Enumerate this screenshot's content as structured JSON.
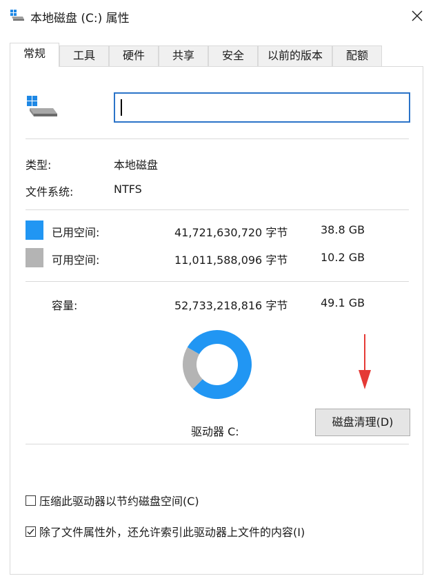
{
  "window": {
    "title": "本地磁盘 (C:) 属性",
    "close_label": "✕"
  },
  "tabs": [
    {
      "label": "常规",
      "active": true
    },
    {
      "label": "工具",
      "active": false
    },
    {
      "label": "硬件",
      "active": false
    },
    {
      "label": "共享",
      "active": false
    },
    {
      "label": "安全",
      "active": false
    },
    {
      "label": "以前的版本",
      "active": false
    },
    {
      "label": "配额",
      "active": false
    }
  ],
  "general": {
    "name_value": "",
    "type_label": "类型:",
    "type_value": "本地磁盘",
    "fs_label": "文件系统:",
    "fs_value": "NTFS",
    "used": {
      "label": "已用空间:",
      "bytes": "41,721,630,720 字节",
      "size": "38.8 GB",
      "color": "#2196f3"
    },
    "free": {
      "label": "可用空间:",
      "bytes": "11,011,588,096 字节",
      "size": "10.2 GB",
      "color": "#b4b4b4"
    },
    "capacity": {
      "label": "容量:",
      "bytes": "52,733,218,816 字节",
      "size": "49.1 GB"
    },
    "drive_label": "驱动器 C:",
    "cleanup_button": "磁盘清理(D)",
    "compress_label": "压缩此驱动器以节约磁盘空间(C)",
    "compress_checked": false,
    "index_label": "除了文件属性外，还允许索引此驱动器上文件的内容(I)",
    "index_checked": true
  },
  "chart_data": {
    "type": "pie",
    "labels": [
      "已用空间",
      "可用空间"
    ],
    "values": [
      41721630720,
      11011588096
    ],
    "colors": [
      "#2196f3",
      "#b4b4b4"
    ]
  },
  "annotation_color": "#e53935"
}
